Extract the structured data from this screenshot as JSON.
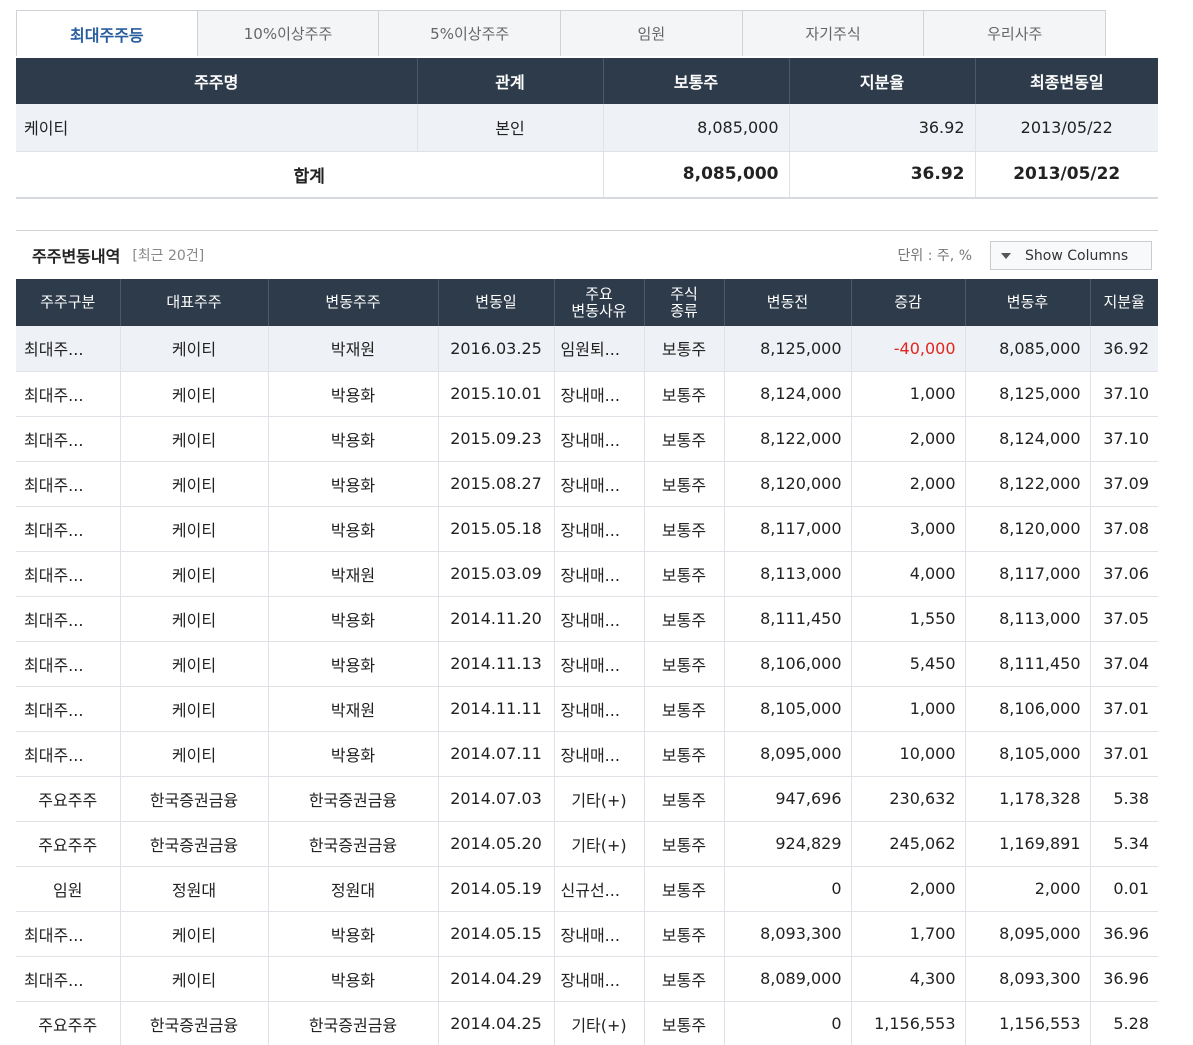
{
  "tabs": [
    {
      "label": "최대주주등",
      "active": true
    },
    {
      "label": "10%이상주주",
      "active": false
    },
    {
      "label": "5%이상주주",
      "active": false
    },
    {
      "label": "임원",
      "active": false
    },
    {
      "label": "자기주식",
      "active": false
    },
    {
      "label": "우리사주",
      "active": false
    }
  ],
  "summary": {
    "headers": [
      "주주명",
      "관계",
      "보통주",
      "지분율",
      "최종변동일"
    ],
    "row": {
      "name": "케이티",
      "relation": "본인",
      "common": "8,085,000",
      "ratio": "36.92",
      "date": "2013/05/22"
    },
    "total": {
      "label": "합계",
      "common": "8,085,000",
      "ratio": "36.92",
      "date": "2013/05/22"
    }
  },
  "changes": {
    "title": "주주변동내역",
    "recent": "[최근 20건]",
    "unit": "단위 : 주, %",
    "show_columns": "Show Columns",
    "headers": [
      "주주구분",
      "대표주주",
      "변동주주",
      "변동일",
      "주요\n변동사유",
      "주식\n종류",
      "변동전",
      "증감",
      "변동후",
      "지분율"
    ],
    "rows": [
      [
        "최대주...",
        "케이티",
        "박재원",
        "2016.03.25",
        "임원퇴...",
        "보통주",
        "8,125,000",
        "-40,000",
        "8,085,000",
        "36.92"
      ],
      [
        "최대주...",
        "케이티",
        "박용화",
        "2015.10.01",
        "장내매...",
        "보통주",
        "8,124,000",
        "1,000",
        "8,125,000",
        "37.10"
      ],
      [
        "최대주...",
        "케이티",
        "박용화",
        "2015.09.23",
        "장내매...",
        "보통주",
        "8,122,000",
        "2,000",
        "8,124,000",
        "37.10"
      ],
      [
        "최대주...",
        "케이티",
        "박용화",
        "2015.08.27",
        "장내매...",
        "보통주",
        "8,120,000",
        "2,000",
        "8,122,000",
        "37.09"
      ],
      [
        "최대주...",
        "케이티",
        "박용화",
        "2015.05.18",
        "장내매...",
        "보통주",
        "8,117,000",
        "3,000",
        "8,120,000",
        "37.08"
      ],
      [
        "최대주...",
        "케이티",
        "박재원",
        "2015.03.09",
        "장내매...",
        "보통주",
        "8,113,000",
        "4,000",
        "8,117,000",
        "37.06"
      ],
      [
        "최대주...",
        "케이티",
        "박용화",
        "2014.11.20",
        "장내매...",
        "보통주",
        "8,111,450",
        "1,550",
        "8,113,000",
        "37.05"
      ],
      [
        "최대주...",
        "케이티",
        "박용화",
        "2014.11.13",
        "장내매...",
        "보통주",
        "8,106,000",
        "5,450",
        "8,111,450",
        "37.04"
      ],
      [
        "최대주...",
        "케이티",
        "박재원",
        "2014.11.11",
        "장내매...",
        "보통주",
        "8,105,000",
        "1,000",
        "8,106,000",
        "37.01"
      ],
      [
        "최대주...",
        "케이티",
        "박용화",
        "2014.07.11",
        "장내매...",
        "보통주",
        "8,095,000",
        "10,000",
        "8,105,000",
        "37.01"
      ],
      [
        "주요주주",
        "한국증권금융",
        "한국증권금융",
        "2014.07.03",
        "기타(+)",
        "보통주",
        "947,696",
        "230,632",
        "1,178,328",
        "5.38"
      ],
      [
        "주요주주",
        "한국증권금융",
        "한국증권금융",
        "2014.05.20",
        "기타(+)",
        "보통주",
        "924,829",
        "245,062",
        "1,169,891",
        "5.34"
      ],
      [
        "임원",
        "정원대",
        "정원대",
        "2014.05.19",
        "신규선...",
        "보통주",
        "0",
        "2,000",
        "2,000",
        "0.01"
      ],
      [
        "최대주...",
        "케이티",
        "박용화",
        "2014.05.15",
        "장내매...",
        "보통주",
        "8,093,300",
        "1,700",
        "8,095,000",
        "36.96"
      ],
      [
        "최대주...",
        "케이티",
        "박용화",
        "2014.04.29",
        "장내매...",
        "보통주",
        "8,089,000",
        "4,300",
        "8,093,300",
        "36.96"
      ],
      [
        "주요주주",
        "한국증권금융",
        "한국증권금융",
        "2014.04.25",
        "기타(+)",
        "보통주",
        "0",
        "1,156,553",
        "1,156,553",
        "5.28"
      ]
    ]
  },
  "colors": {
    "header_bg": "#2e3b4a",
    "active_tab": "#2a5d9f",
    "negative": "#e0261e"
  }
}
